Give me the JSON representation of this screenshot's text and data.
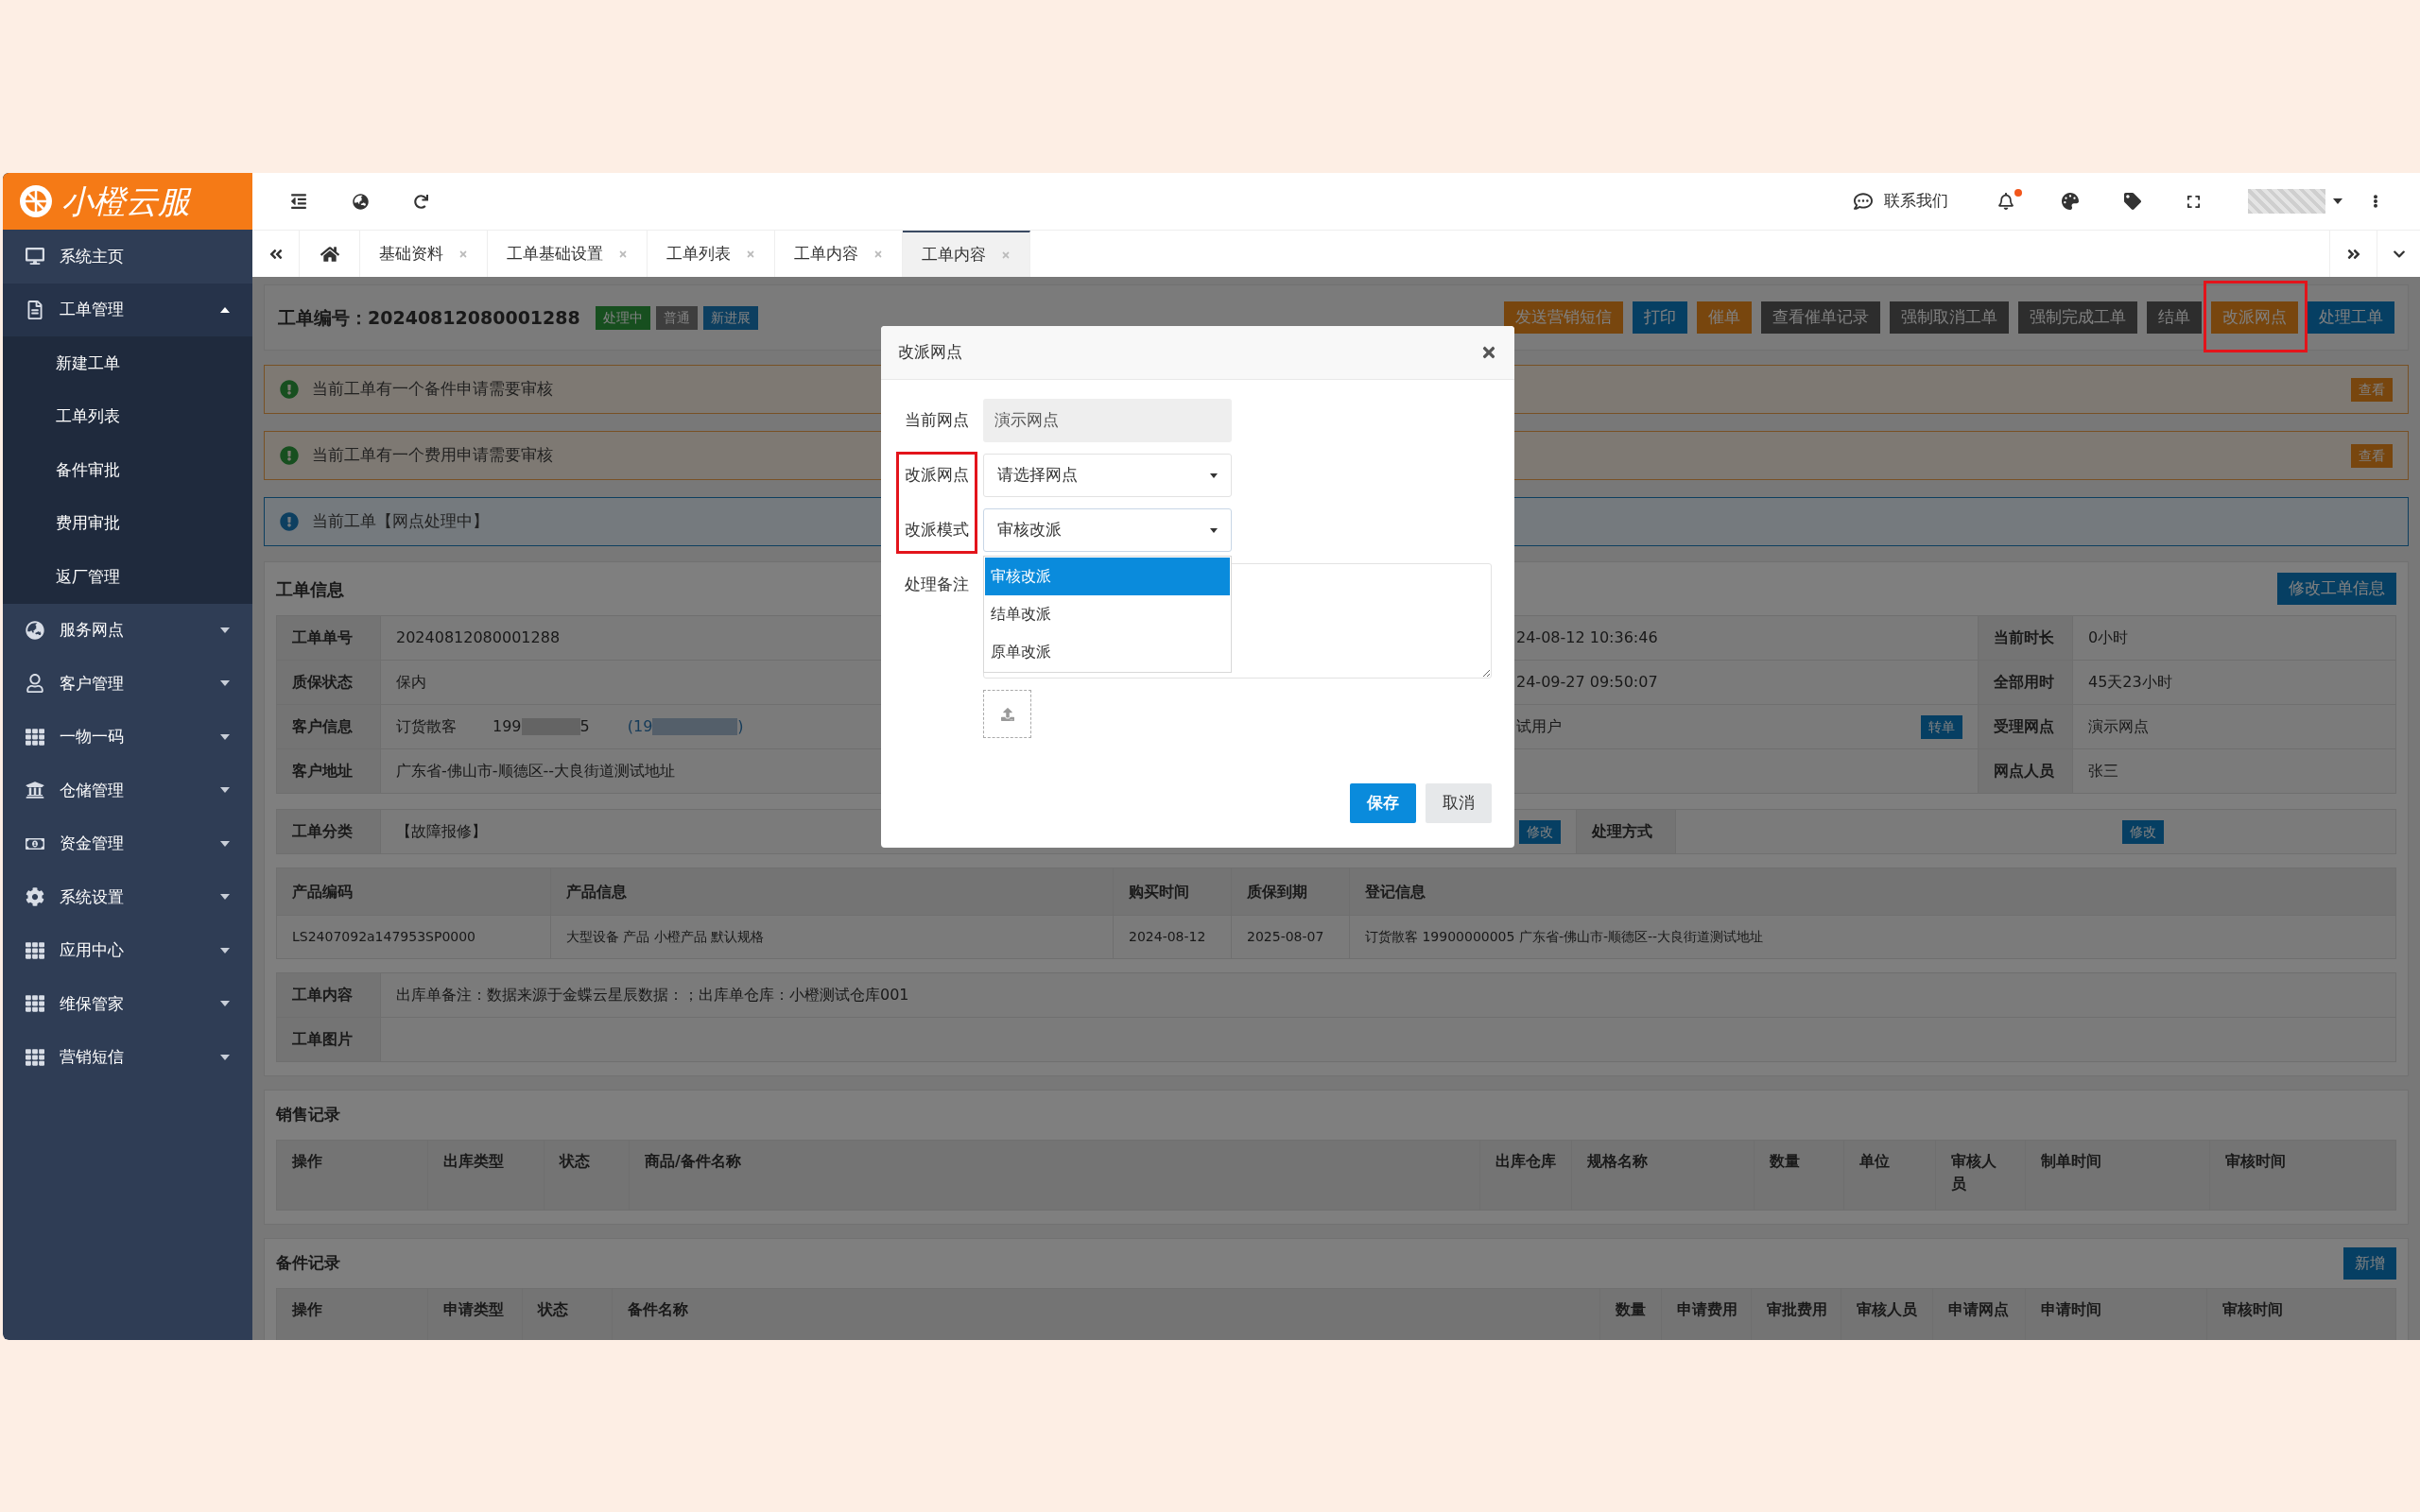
{
  "logo": {
    "text": "小橙云服"
  },
  "sidebar": {
    "items": [
      {
        "label": "系统主页"
      },
      {
        "label": "工单管理",
        "expanded": true,
        "children": [
          {
            "label": "新建工单"
          },
          {
            "label": "工单列表"
          },
          {
            "label": "备件审批"
          },
          {
            "label": "费用审批"
          },
          {
            "label": "返厂管理"
          }
        ]
      },
      {
        "label": "服务网点",
        "expanded": false
      },
      {
        "label": "客户管理",
        "expanded": false
      },
      {
        "label": "一物一码",
        "expanded": false
      },
      {
        "label": "仓储管理",
        "expanded": false
      },
      {
        "label": "资金管理",
        "expanded": false
      },
      {
        "label": "系统设置",
        "expanded": false
      },
      {
        "label": "应用中心",
        "expanded": false
      },
      {
        "label": "维保管家",
        "expanded": false
      },
      {
        "label": "营销短信",
        "expanded": false
      }
    ]
  },
  "top_bar": {
    "contact": "联系我们",
    "unread_notifications": true
  },
  "tabs": [
    {
      "label": "基础资料",
      "selected": false
    },
    {
      "label": "工单基础设置",
      "selected": false
    },
    {
      "label": "工单列表",
      "selected": false
    },
    {
      "label": "工单内容",
      "selected": false
    },
    {
      "label": "工单内容",
      "selected": true
    }
  ],
  "order_header": {
    "title": "工单编号：20240812080001288",
    "badges": [
      {
        "label": "处理中",
        "kind": "success"
      },
      {
        "label": "普通",
        "kind": "muted"
      },
      {
        "label": "新进展",
        "kind": "info"
      }
    ],
    "actions": [
      {
        "label": "发送营销短信",
        "kind": "warning",
        "highlighted": false
      },
      {
        "label": "打印",
        "kind": "primary",
        "highlighted": false
      },
      {
        "label": "催单",
        "kind": "warning",
        "highlighted": false
      },
      {
        "label": "查看催单记录",
        "kind": "dark",
        "highlighted": false
      },
      {
        "label": "强制取消工单",
        "kind": "dark",
        "highlighted": false
      },
      {
        "label": "强制完成工单",
        "kind": "dark",
        "highlighted": false
      },
      {
        "label": "结单",
        "kind": "dark",
        "highlighted": false
      },
      {
        "label": "改派网点",
        "kind": "warning",
        "highlighted": true
      },
      {
        "label": "处理工单",
        "kind": "primary",
        "highlighted": false
      }
    ]
  },
  "alerts": [
    {
      "kind": "warning",
      "text": "当前工单有一个备件申请需要审核",
      "action": "查看"
    },
    {
      "kind": "warning",
      "text": "当前工单有一个费用申请需要审核",
      "action": "查看"
    },
    {
      "kind": "info",
      "text": "当前工单【网点处理中】"
    }
  ],
  "order_info": {
    "title": "工单信息",
    "edit_button": "修改工单信息",
    "rows": [
      {
        "label": "工单单号",
        "value": "20240812080001288",
        "value_2": "24-08-12 10:36:46",
        "label_3": "当前时长",
        "value_3": "0小时"
      },
      {
        "label": "质保状态",
        "value": "保内",
        "value_2": "24-09-27 09:50:07",
        "label_3": "全部用时",
        "value_3": "45天23小时"
      },
      {
        "label": "客户信息",
        "value": "订货散客",
        "phone_start": "199",
        "phone_end": "5",
        "alt_phone_start": "(19",
        "alt_phone_end": ")",
        "value_2": "试用户",
        "value_2_button": "转单",
        "label_3": "受理网点",
        "value_3": "演示网点"
      },
      {
        "label": "客户地址",
        "value": "广东省-佛山市-顺德区--大良街道测试地址",
        "label_3": "网点人员",
        "value_3": "张三"
      }
    ],
    "category": {
      "label": "工单分类",
      "value": "【故障报修】",
      "edit_button": "修改",
      "label_2": "处理方式",
      "edit_button_2": "修改"
    },
    "products": {
      "columns": [
        "产品编码",
        "产品信息",
        "购买时间",
        "质保到期",
        "登记信息"
      ],
      "rows": [
        [
          "LS2407092a147953SP0000",
          "大型设备 产品 小橙产品 默认规格",
          "2024-08-12",
          "2025-08-07",
          "订货散客 19900000005 广东省-佛山市-顺德区--大良街道测试地址"
        ]
      ]
    },
    "details": [
      {
        "label": "工单内容",
        "value": "出库单备注：数据来源于金蝶云星辰数据：；出库单仓库：小橙测试仓库001"
      },
      {
        "label": "工单图片"
      }
    ]
  },
  "sales_records": {
    "title": "销售记录",
    "columns": [
      "操作",
      "出库类型",
      "状态",
      "商品/备件名称",
      "出库仓库",
      "规格名称",
      "数量",
      "单位",
      "审核人员",
      "制单时间",
      "审核时间"
    ]
  },
  "parts_records": {
    "title": "备件记录",
    "add_button": "新增",
    "columns": [
      "操作",
      "申请类型",
      "状态",
      "备件名称",
      "数量",
      "申请费用",
      "审批费用",
      "审核人员",
      "申请网点",
      "申请时间",
      "审核时间"
    ]
  },
  "modal": {
    "title": "改派网点",
    "fields": [
      {
        "kind": "readonly",
        "label": "当前网点",
        "value": "演示网点",
        "highlighted": false
      },
      {
        "kind": "select",
        "label": "改派网点",
        "placeholder": "请选择网点",
        "highlighted": true,
        "expanded": false
      },
      {
        "kind": "select",
        "label": "改派模式",
        "value": "审核改派",
        "highlighted": true,
        "expanded": true,
        "options": [
          {
            "label": "审核改派",
            "selected": true
          },
          {
            "label": "结单改派",
            "selected": false
          },
          {
            "label": "原单改派",
            "selected": false
          }
        ]
      },
      {
        "kind": "textarea",
        "label": "处理备注",
        "highlighted": false
      }
    ],
    "buttons": [
      {
        "label": "保存",
        "kind": "primary"
      },
      {
        "label": "取消",
        "kind": "default"
      }
    ]
  }
}
